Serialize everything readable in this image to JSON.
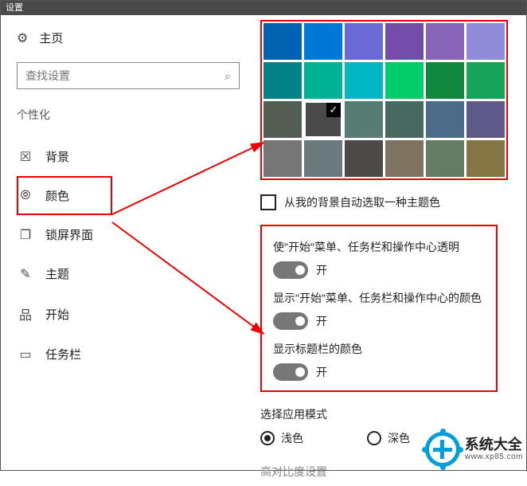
{
  "window_title": "设置",
  "sidebar": {
    "home": "主页",
    "search_placeholder": "查找设置",
    "category": "个性化",
    "items": [
      {
        "icon": "image-icon",
        "glyph": "☒",
        "label": "背景"
      },
      {
        "icon": "palette-icon",
        "glyph": "⦾",
        "label": "颜色",
        "selected": true
      },
      {
        "icon": "lock-screen-icon",
        "glyph": "❐",
        "label": "锁屏界面"
      },
      {
        "icon": "theme-icon",
        "glyph": "✎",
        "label": "主题"
      },
      {
        "icon": "start-icon",
        "glyph": "品",
        "label": "开始"
      },
      {
        "icon": "taskbar-icon",
        "glyph": "▭",
        "label": "任务栏"
      }
    ]
  },
  "palette": {
    "selected_index": 13,
    "colors": [
      "#0063b1",
      "#0078d7",
      "#6b69d6",
      "#744da9",
      "#8764b8",
      "#8e8cd8",
      "#038387",
      "#00b294",
      "#00b7c3",
      "#00cc6a",
      "#10893e",
      "#18a35a",
      "#525e54",
      "#4a4a4a",
      "#567c73",
      "#486860",
      "#4c6b8a",
      "#5d5a88",
      "#767676",
      "#69797e",
      "#4c4a48",
      "#7e735f",
      "#647c64",
      "#847545"
    ]
  },
  "auto_pick": {
    "label": "从我的背景自动选取一种主题色",
    "checked": false
  },
  "toggles": {
    "transparency": {
      "label": "使\"开始\"菜单、任务栏和操作中心透明",
      "state": "开"
    },
    "color_on_start": {
      "label": "显示\"开始\"菜单、任务栏和操作中心的颜色",
      "state": "开"
    },
    "color_on_title": {
      "label": "显示标题栏的颜色",
      "state": "开"
    }
  },
  "mode": {
    "title": "选择应用模式",
    "light": "浅色",
    "dark": "深色",
    "selected": "light"
  },
  "contrast": "高对比度设置",
  "watermark": {
    "line1": "系统大全",
    "line2": "www.xp85.com"
  }
}
